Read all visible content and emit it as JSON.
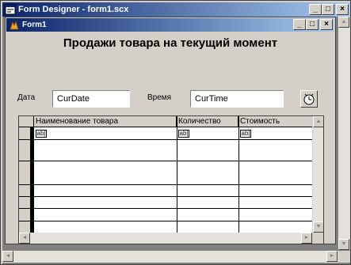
{
  "designer": {
    "title": "Form Designer - form1.scx",
    "min_glyph": "_",
    "max_glyph": "□",
    "close_glyph": "×"
  },
  "form": {
    "title": "Form1",
    "heading": "Продажи товара на текущий момент",
    "date_label": "Дата",
    "date_value": "CurDate",
    "time_label": "Время",
    "time_value": "CurTime",
    "min_glyph": "_",
    "max_glyph": "□",
    "close_glyph": "×"
  },
  "grid": {
    "columns": [
      {
        "header": "Наименование товара"
      },
      {
        "header": "Количество"
      },
      {
        "header": "Стоимость"
      }
    ],
    "cell_placeholder": "ab|"
  },
  "icons": {
    "window_icon": "form-designer-icon",
    "form_icon": "fox-icon",
    "timer": "timer-icon",
    "arrow_up": "▲",
    "arrow_down": "▼",
    "arrow_left": "◄",
    "arrow_right": "►"
  }
}
